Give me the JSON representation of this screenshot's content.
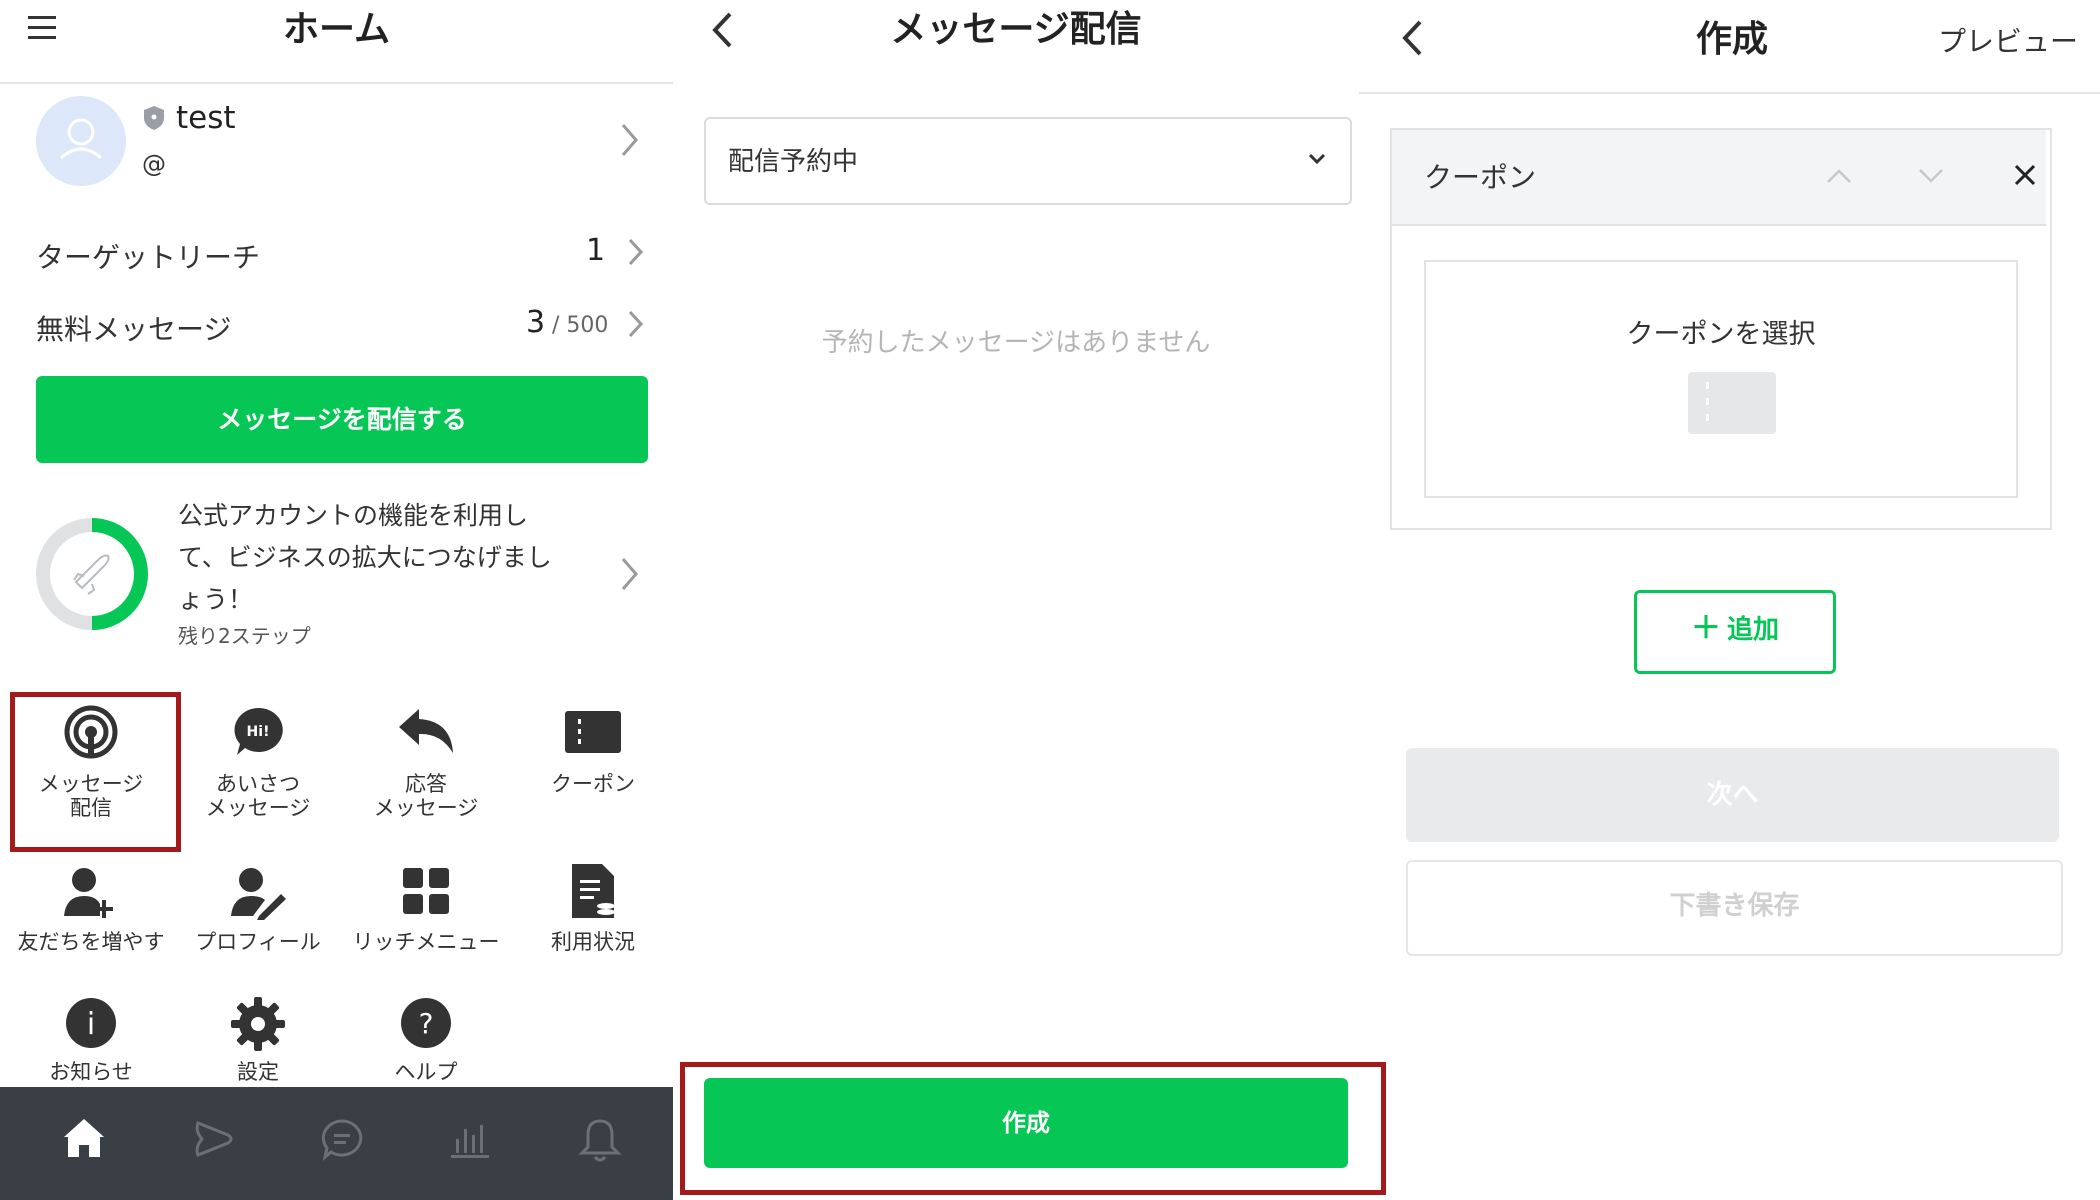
{
  "home": {
    "title": "ホーム",
    "account": {
      "name": "test",
      "id": "@"
    },
    "target_reach": {
      "label": "ターゲットリーチ",
      "value": "1"
    },
    "free_messages": {
      "label": "無料メッセージ",
      "used": "3",
      "limit": "/ 500"
    },
    "send_button": "メッセージを配信する",
    "progress": {
      "text_line1": "公式アカウントの機能を利用し",
      "text_line2": "て、ビジネスの拡大につなげまし",
      "text_line3": "ょう！",
      "steps_left": "残り2ステップ",
      "ratio": 0.5
    },
    "grid": [
      {
        "label": "メッセージ\n配信",
        "icon": "broadcast-icon"
      },
      {
        "label": "あいさつ\nメッセージ",
        "icon": "greeting-bubble-icon",
        "badge": "Hi!"
      },
      {
        "label": "応答\nメッセージ",
        "icon": "reply-arrow-icon"
      },
      {
        "label": "クーポン",
        "icon": "coupon-icon"
      },
      {
        "label": "友だちを増やす",
        "icon": "add-friend-icon"
      },
      {
        "label": "プロフィール",
        "icon": "profile-edit-icon"
      },
      {
        "label": "リッチメニュー",
        "icon": "rich-menu-icon"
      },
      {
        "label": "利用状況",
        "icon": "usage-icon"
      },
      {
        "label": "お知らせ",
        "icon": "info-icon",
        "glyph": "i"
      },
      {
        "label": "設定",
        "icon": "gear-icon"
      },
      {
        "label": "ヘルプ",
        "icon": "help-icon",
        "glyph": "?"
      }
    ],
    "bottom_nav": [
      "home-icon",
      "timeline-icon",
      "chat-icon",
      "analytics-icon",
      "notification-icon"
    ]
  },
  "broadcast": {
    "title": "メッセージ配信",
    "filter_value": "配信予約中",
    "empty_message": "予約したメッセージはありません",
    "create_button": "作成"
  },
  "compose": {
    "title": "作成",
    "preview_link": "プレビュー",
    "block_title": "クーポン",
    "select_coupon": "クーポンを選択",
    "add_button": "追加",
    "add_icon": "＋",
    "next_button": "次へ",
    "save_draft_button": "下書き保存"
  },
  "colors": {
    "brand_green": "#06c755",
    "highlight_red": "#a41a1a",
    "nav_bg": "#3a3f45"
  }
}
